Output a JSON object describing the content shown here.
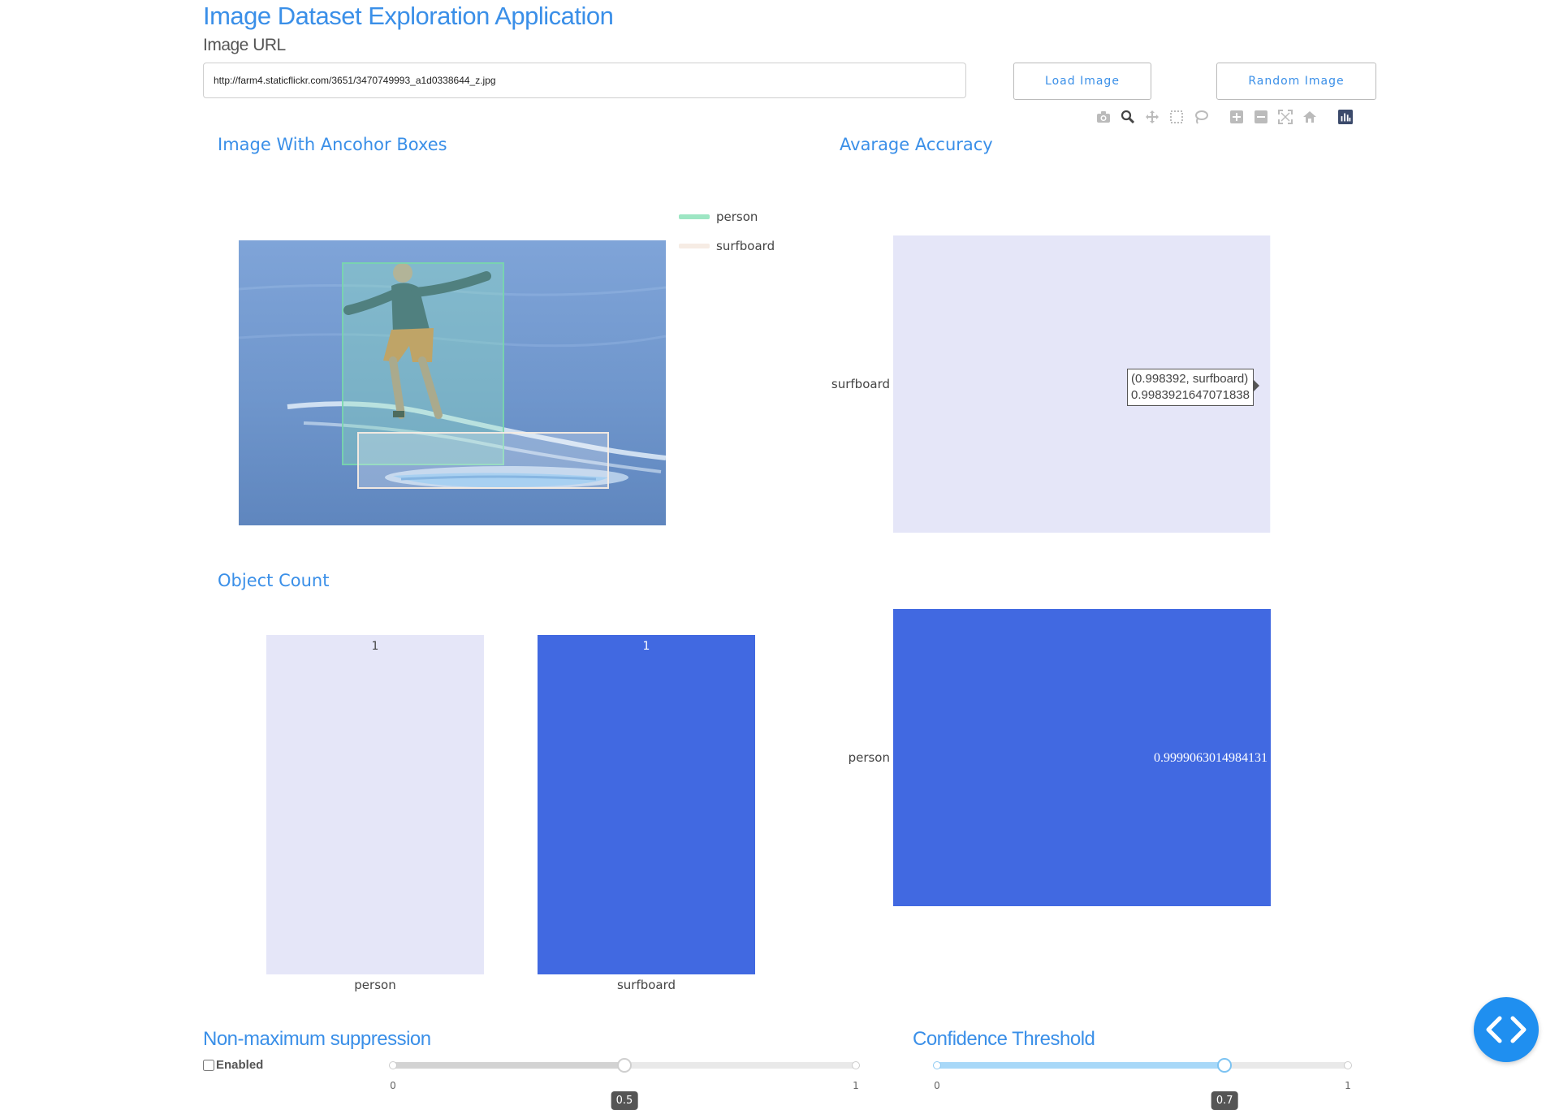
{
  "app": {
    "title": "Image Dataset Exploration Application",
    "url_label": "Image URL",
    "url_value": "http://farm4.staticflickr.com/3651/3470749993_a1d0338644_z.jpg",
    "load_button": "Load Image",
    "random_button": "Random Image"
  },
  "modebar": [
    "camera-icon",
    "zoom-icon",
    "pan-icon",
    "box-select-icon",
    "lasso-icon",
    "zoom-in-icon",
    "zoom-out-icon",
    "autoscale-icon",
    "reset-axes-icon",
    "plotly-logo-icon"
  ],
  "panels": {
    "anchor_title": "Image With Ancohor Boxes",
    "accuracy_title": "Avarage Accuracy",
    "count_title": "Object Count"
  },
  "legend": [
    {
      "name": "person",
      "color": "#9de6c3"
    },
    {
      "name": "surfboard",
      "color": "#f6ece4"
    }
  ],
  "colors": {
    "accent": "#3a8fe8",
    "bar_light": "#e5e6f8",
    "bar_dark": "#4169e1"
  },
  "tooltip": {
    "line1": "(0.998392, surfboard)",
    "line2": "0.9983921647071838"
  },
  "chart_data": [
    {
      "type": "bar",
      "orientation": "horizontal",
      "title": "Avarage Accuracy",
      "categories": [
        "surfboard",
        "person"
      ],
      "values": [
        0.9983921647071838,
        0.9999063014984131
      ],
      "data_labels": [
        "",
        "0.9999063014984131"
      ]
    },
    {
      "type": "bar",
      "orientation": "vertical",
      "title": "Object Count",
      "categories": [
        "person",
        "surfboard"
      ],
      "values": [
        1,
        1
      ],
      "data_labels": [
        "1",
        "1"
      ]
    }
  ],
  "nms": {
    "title": "Non-maximum suppression",
    "enabled_label": "Enabled",
    "enabled": false,
    "min_label": "0",
    "max_label": "1",
    "min": 0,
    "max": 1,
    "value": 0.5,
    "value_label": "0.5"
  },
  "confidence": {
    "title": "Confidence Threshold",
    "min_label": "0",
    "max_label": "1",
    "min": 0,
    "max": 1,
    "value": 0.7,
    "value_label": "0.7"
  }
}
